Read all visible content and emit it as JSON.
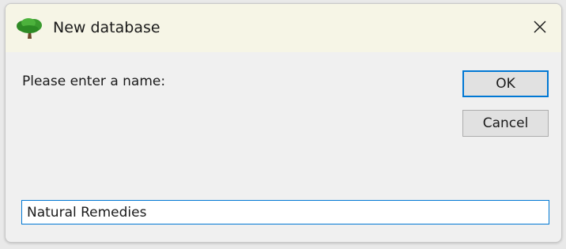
{
  "window": {
    "title": "New database",
    "icon": "tree-icon",
    "close_icon": "close-icon"
  },
  "dialog": {
    "prompt": "Please enter a name:",
    "ok_label": "OK",
    "cancel_label": "Cancel",
    "name_value": "Natural Remedies"
  },
  "colors": {
    "titlebar_bg": "#f6f5e6",
    "dialog_bg": "#f0f0f0",
    "accent": "#0078d4",
    "icon_green": "#3a9a2e"
  }
}
